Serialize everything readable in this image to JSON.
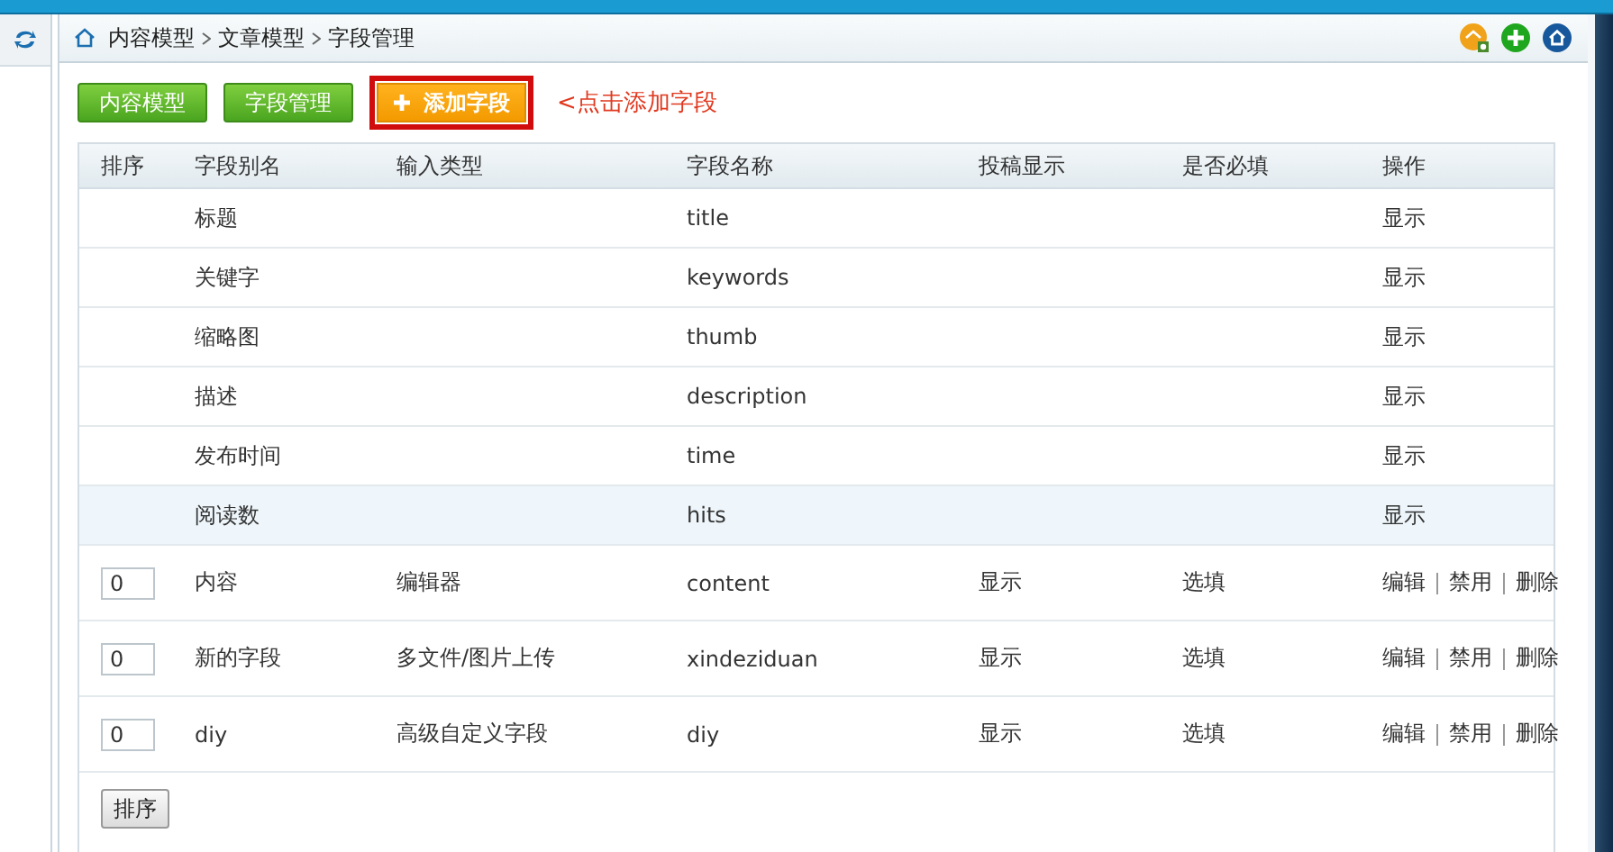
{
  "breadcrumb": [
    "内容模型",
    "文章模型",
    "字段管理"
  ],
  "buttons": [
    {
      "label": "内容模型",
      "kind": "green"
    },
    {
      "label": "字段管理",
      "kind": "green"
    },
    {
      "label": "添加字段",
      "kind": "add"
    }
  ],
  "hint": "<点击添加字段",
  "table": {
    "columns": [
      "排序",
      "字段别名",
      "输入类型",
      "字段名称",
      "投稿显示",
      "是否必填",
      "操作"
    ],
    "rows": [
      {
        "kind": "system",
        "highlighted": false,
        "alias": "标题",
        "name": "title",
        "action": "显示"
      },
      {
        "kind": "system",
        "highlighted": false,
        "alias": "关键字",
        "name": "keywords",
        "action": "显示"
      },
      {
        "kind": "system",
        "highlighted": false,
        "alias": "缩略图",
        "name": "thumb",
        "action": "显示"
      },
      {
        "kind": "system",
        "highlighted": false,
        "alias": "描述",
        "name": "description",
        "action": "显示"
      },
      {
        "kind": "system",
        "highlighted": false,
        "alias": "发布时间",
        "name": "time",
        "action": "显示"
      },
      {
        "kind": "system",
        "highlighted": true,
        "alias": "阅读数",
        "name": "hits",
        "action": "显示"
      },
      {
        "kind": "custom",
        "highlighted": false,
        "order": "0",
        "alias": "内容",
        "input_type": "编辑器",
        "name": "content",
        "contribute": "显示",
        "required": "选填",
        "actions": [
          "编辑",
          "禁用",
          "删除"
        ]
      },
      {
        "kind": "custom",
        "highlighted": false,
        "order": "0",
        "alias": "新的字段",
        "input_type": "多文件/图片上传",
        "name": "xindeziduan",
        "contribute": "显示",
        "required": "选填",
        "actions": [
          "编辑",
          "禁用",
          "删除"
        ]
      },
      {
        "kind": "custom",
        "highlighted": false,
        "order": "0",
        "alias": "diy",
        "input_type": "高级自定义字段",
        "name": "diy",
        "contribute": "显示",
        "required": "选填",
        "actions": [
          "编辑",
          "禁用",
          "删除"
        ]
      }
    ]
  },
  "sort_button": "排序"
}
